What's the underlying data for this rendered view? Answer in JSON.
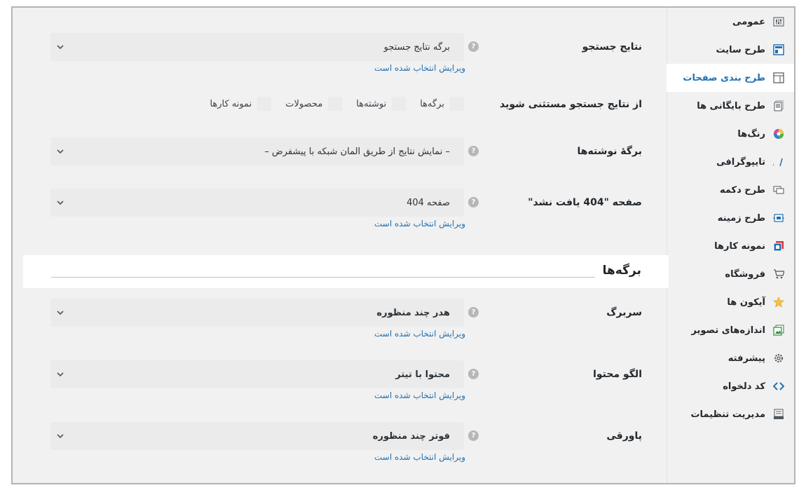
{
  "sidebar": {
    "items": [
      {
        "label": "عمومی",
        "icon": "sliders-icon"
      },
      {
        "label": "طرح سایت",
        "icon": "site-layout-icon"
      },
      {
        "label": "طرح بندی صفحات",
        "icon": "page-layout-icon",
        "active": true
      },
      {
        "label": "طرح بایگانی ها",
        "icon": "archive-icon"
      },
      {
        "label": "رنگ‌ها",
        "icon": "color-wheel-icon"
      },
      {
        "label": "تایپوگرافی",
        "icon": "typography-icon"
      },
      {
        "label": "طرح دکمه",
        "icon": "button-icon"
      },
      {
        "label": "طرح زمینه",
        "icon": "background-icon"
      },
      {
        "label": "نمونه کارها",
        "icon": "portfolio-icon"
      },
      {
        "label": "فروشگاه",
        "icon": "cart-icon"
      },
      {
        "label": "آیکون ها",
        "icon": "star-icon"
      },
      {
        "label": "اندازه‌های تصویر",
        "icon": "image-sizes-icon"
      },
      {
        "label": "پیشرفته",
        "icon": "gear-icon"
      },
      {
        "label": "کد دلخواه",
        "icon": "code-icon"
      },
      {
        "label": "مدیریت تنظیمات",
        "icon": "settings-manager-icon"
      }
    ]
  },
  "rows": {
    "search_results": {
      "label": "نتایج جستجو",
      "value": "برگه نتایج جستجو",
      "edit": "ویرایش انتخاب شده است"
    },
    "exclude": {
      "label": "از نتایج جستجو مستثنی شوید",
      "options": [
        "برگه‌ها",
        "نوشته‌ها",
        "محصولات",
        "نمونه کارها"
      ]
    },
    "posts_page": {
      "label": "برگهٔ نوشته‌ها",
      "value": "– نمایش نتایج از طریق المان شبکه با پیشفرض –"
    },
    "not_found": {
      "label": "صفحه \"404 یافت نشد\"",
      "value": "صفحه 404",
      "edit": "ویرایش انتخاب شده است"
    },
    "header": {
      "label": "سربرگ",
      "value": "هدر چند منظوره",
      "edit": "ویرایش انتخاب شده است"
    },
    "content_template": {
      "label": "الگو محتوا",
      "value": "محتوا با تیتر",
      "edit": "ویرایش انتخاب شده است"
    },
    "footer": {
      "label": "پاورقی",
      "value": "فوتر چند منظوره",
      "edit": "ویرایش انتخاب شده است"
    }
  },
  "section": {
    "title": "برگه‌ها"
  },
  "help_glyph": "?",
  "colors": {
    "accent": "#2271b1",
    "panel": "#f1f1f1",
    "field": "#ebebeb"
  }
}
